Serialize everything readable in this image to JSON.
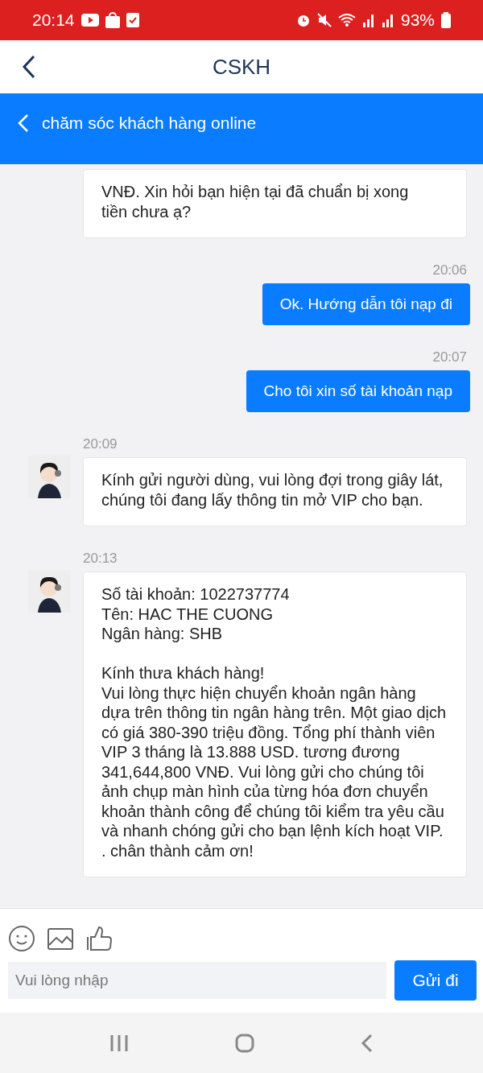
{
  "status_bar": {
    "time": "20:14",
    "battery": "93%"
  },
  "header": {
    "title": "CSKH"
  },
  "banner": {
    "title": "chăm sóc khách hàng online"
  },
  "messages": [
    {
      "kind": "agent",
      "text": "VNĐ. Xin hỏi bạn hiện tại đã chuẩn bị xong\ntiền chưa ạ?"
    },
    {
      "kind": "user",
      "time": "20:06",
      "text": "Ok. Hướng dẫn tôi nạp đi"
    },
    {
      "kind": "user",
      "time": "20:07",
      "text": "Cho tôi xin số tài khoản nạp"
    },
    {
      "kind": "agent",
      "time": "20:09",
      "text": "Kính gửi người dùng, vui lòng đợi trong giây lát, chúng tôi đang lấy thông tin mở VIP cho bạn."
    },
    {
      "kind": "agent",
      "time": "20:13",
      "text": "Số tài khoản: 1022737774\nTên: HAC THE CUONG\nNgân hàng: SHB\n\nKính thưa khách hàng!\nVui lòng thực hiện chuyển khoản ngân hàng dựa trên thông tin ngân hàng trên. Một giao dịch có giá 380-390 triệu đồng. Tổng phí thành viên VIP 3 tháng là 13.888 USD. tương đương 341,644,800 VNĐ. Vui lòng gửi cho chúng tôi ảnh chụp màn hình của từng hóa đơn chuyển khoản thành công để chúng tôi kiểm tra yêu cầu và nhanh chóng gửi cho bạn lệnh kích hoạt VIP. . chân thành cảm ơn!"
    }
  ],
  "composer": {
    "placeholder": "Vui lòng nhập",
    "send_button": "Gửi đi"
  }
}
